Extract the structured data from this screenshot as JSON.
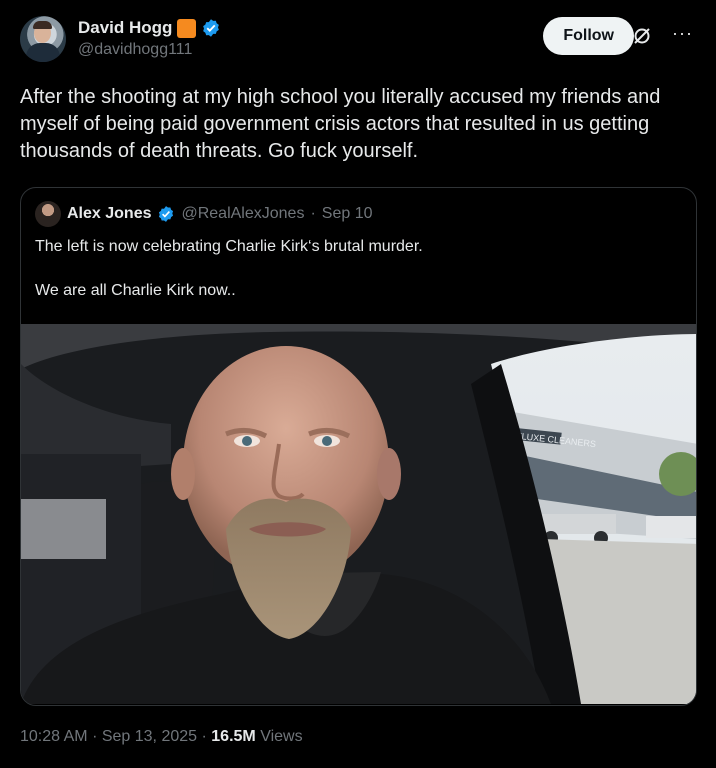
{
  "author": {
    "display_name": "David Hogg",
    "handle": "@davidhogg111",
    "badge_color": "#f58a1f",
    "verified_color": "#1d9bf0"
  },
  "actions": {
    "follow_label": "Follow",
    "grok_icon": "grok-icon",
    "more_icon": "more-icon"
  },
  "tweet": {
    "text": "After the shooting at my high school you literally accused my friends and myself of being paid government crisis actors that resulted in us getting thousands of death threats. Go fuck yourself."
  },
  "quote": {
    "display_name": "Alex Jones",
    "handle": "@RealAlexJones",
    "separator": "·",
    "date": "Sep 10",
    "line1": "The left is now celebrating Charlie Kirk‘s brutal murder.",
    "line2": "We are all Charlie Kirk now..",
    "media_sign": "DELUXE CLEANERS"
  },
  "meta": {
    "time": "10:28 AM",
    "sep1": "·",
    "date": "Sep 13, 2025",
    "sep2": "·",
    "views_count": "16.5M",
    "views_label": "Views"
  }
}
